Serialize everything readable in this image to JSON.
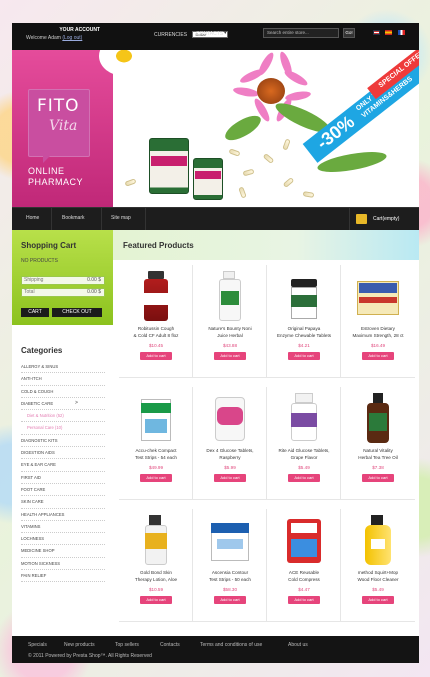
{
  "account": {
    "title": "YOUR ACCOUNT",
    "welcome": "Welcome Adam",
    "logout": "(Log out)"
  },
  "currencies": {
    "label": "CURRENCIES",
    "selected": "Dollar"
  },
  "contacts_label": "CONTACTS",
  "search": {
    "placeholder": "Search entire store...",
    "button": "Go!"
  },
  "logo": {
    "line1": "FITO",
    "line2": "Vita"
  },
  "tagline": {
    "line1": "ONLINE",
    "line2": "PHARMACY"
  },
  "banner": {
    "percent": "-30%",
    "text1": "ONLY TODAY",
    "text2": "VITAMINS&HERBS",
    "special": "SPECIAL OFFER!"
  },
  "nav": {
    "items": [
      "Home",
      "Bookmark",
      "Site map"
    ],
    "cart": "Cart(empty)"
  },
  "cart": {
    "title": "Shopping Cart",
    "empty": "NO PRODUCTS",
    "shipping_label": "Shipping",
    "shipping_value": "0.00 $",
    "total_label": "Total",
    "total_value": "0.00 $",
    "cart_button": "CART",
    "checkout_button": "CHECK OUT"
  },
  "categories": {
    "title": "Categories",
    "items": [
      {
        "label": "ALLERGY & SINUS",
        "sub": false
      },
      {
        "label": "ANTI-ITCH",
        "sub": false
      },
      {
        "label": "COLD & COUGH",
        "sub": false
      },
      {
        "label": "DIABETIC CARE",
        "sub": false,
        "arrow": ">"
      },
      {
        "label": "Diet & Nutrition (52)",
        "sub": true
      },
      {
        "label": "Personal Care (10)",
        "sub": true
      },
      {
        "label": "DIAGNOSTIC KITS",
        "sub": false
      },
      {
        "label": "DIGESTION AIDS",
        "sub": false
      },
      {
        "label": "EYE & EAR CARE",
        "sub": false
      },
      {
        "label": "FIRST AID",
        "sub": false
      },
      {
        "label": "FOOT CARE",
        "sub": false
      },
      {
        "label": "SKIN CARE",
        "sub": false
      },
      {
        "label": "HEALTH APPLIANCES",
        "sub": false
      },
      {
        "label": "VITAMINS",
        "sub": false
      },
      {
        "label": "LOCHNESS",
        "sub": false
      },
      {
        "label": "MEDICINE SHOP",
        "sub": false
      },
      {
        "label": "MOTION SICKNESS",
        "sub": false
      },
      {
        "label": "PAIN RELIEF",
        "sub": false
      }
    ]
  },
  "featured": {
    "title": "Featured Products",
    "button_label": "Add to cart",
    "products": [
      {
        "name1": "Robitussin Cough",
        "name2": "& Cold CF Adult 8 floz",
        "price": "$10.45",
        "icon": "red-syrup-bottle-icon"
      },
      {
        "name1": "Nature's Bounty Noni",
        "name2": "Juice Herbal",
        "price": "$43.88",
        "icon": "noni-juice-bottle-icon"
      },
      {
        "name1": "Original Papaya",
        "name2": "Enzyme Chewable Tablets",
        "price": "$4.21",
        "icon": "papaya-jar-icon"
      },
      {
        "name1": "Estroven Dietary",
        "name2": "Maximum Strength, 28 ct",
        "price": "$16.49",
        "icon": "estroven-box-icon"
      },
      {
        "name1": "Accu-chek Compact",
        "name2": "Test Strips - 54 each",
        "price": "$49.99",
        "icon": "test-strips-box-icon"
      },
      {
        "name1": "Dex 4 Glucose Tablets,",
        "name2": "Raspberry",
        "price": "$5.99",
        "icon": "glucose-tablets-icon"
      },
      {
        "name1": "Rite Aid Glucose Tablets,",
        "name2": "Grape Flavor",
        "price": "$5.49",
        "icon": "rite-aid-bottle-icon"
      },
      {
        "name1": "Natural Vitality",
        "name2": "Herbal Tea Tree Oil",
        "price": "$7.38",
        "icon": "tea-tree-oil-icon"
      },
      {
        "name1": "Gold Bond Skin",
        "name2": "Therapy Lotion, Aloe",
        "price": "$10.59",
        "icon": "lotion-bottle-icon"
      },
      {
        "name1": "Ascensia Contour",
        "name2": "Test Strips - 50 each",
        "price": "$58.30",
        "icon": "contour-box-icon"
      },
      {
        "name1": "ACE Reusable",
        "name2": "Cold Compress",
        "price": "$4.47",
        "icon": "ace-compress-icon"
      },
      {
        "name1": "method Squirt+Mop",
        "name2": "Wood Floor Cleaner",
        "price": "$5.49",
        "icon": "yellow-cleaner-bottle-icon"
      }
    ]
  },
  "footer": {
    "links": [
      "Specials",
      "New products",
      "Top sellers",
      "Contacts",
      "Terms and conditions of use",
      "About us"
    ],
    "copyright": "© 2011 Powered by Presta Shop™. All Rights Reserved"
  },
  "colors": {
    "brand_pink": "#e54c9b",
    "accent_green": "#8cc21e",
    "price_pink": "#e0457b",
    "banner_blue": "#1ea6e3",
    "dark_bar": "#1d1d1d"
  }
}
